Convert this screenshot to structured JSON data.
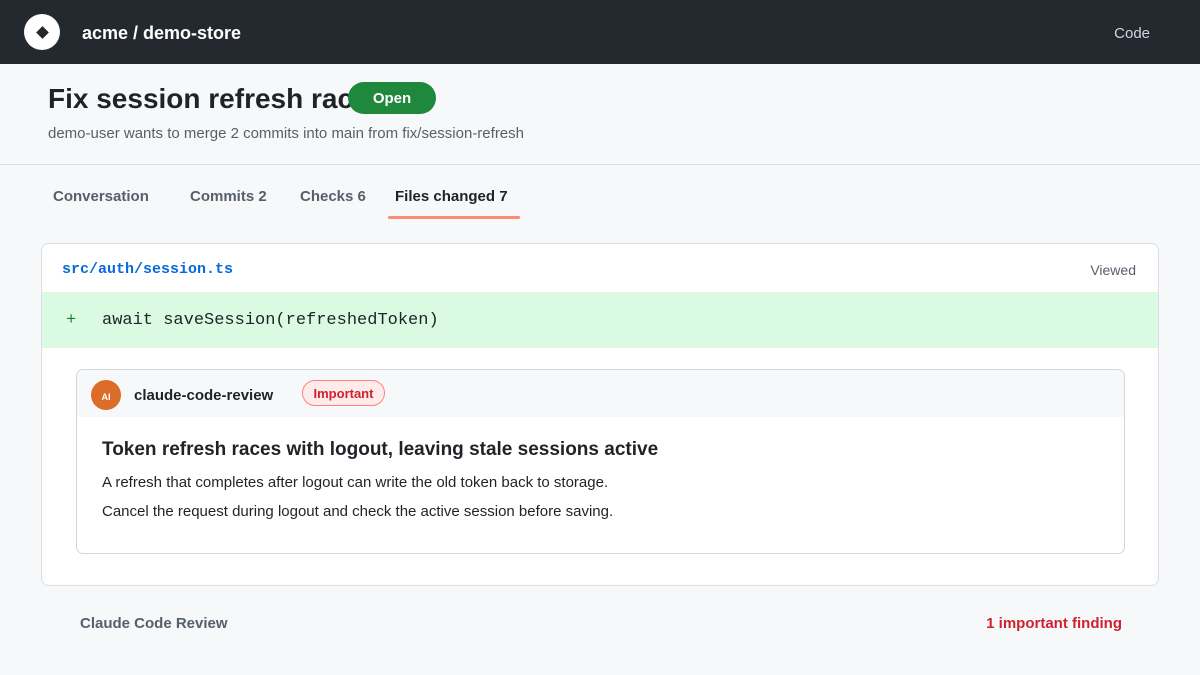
{
  "topbar": {
    "logo_icon": "diamond-logo-icon",
    "repo": "acme / demo-store",
    "nav_code": "Code"
  },
  "pr": {
    "title": "Fix session refresh race",
    "status": "Open",
    "status_color": "#1f883d",
    "meta": "demo-user wants to merge 2 commits into main from fix/session-refresh"
  },
  "tabs": [
    {
      "label": "Conversation"
    },
    {
      "label": "Commits 2"
    },
    {
      "label": "Checks 6"
    },
    {
      "label": "Files changed 7",
      "active": true
    }
  ],
  "file": {
    "path": "src/auth/session.ts",
    "viewed_label": "Viewed",
    "diff": {
      "marker": "+",
      "code": "await saveSession(refreshedToken)"
    }
  },
  "review_comment": {
    "avatar_text": "AI",
    "author": "claude-code-review",
    "badge": "Important",
    "title": "Token refresh races with logout, leaving stale sessions active",
    "body": [
      "A refresh that completes after logout can write the old token back to storage.",
      "Cancel the request during logout and check the active session before saving."
    ]
  },
  "footer": {
    "left": "Claude Code Review",
    "right": "1 important finding",
    "accent_color": "#cf222e"
  }
}
